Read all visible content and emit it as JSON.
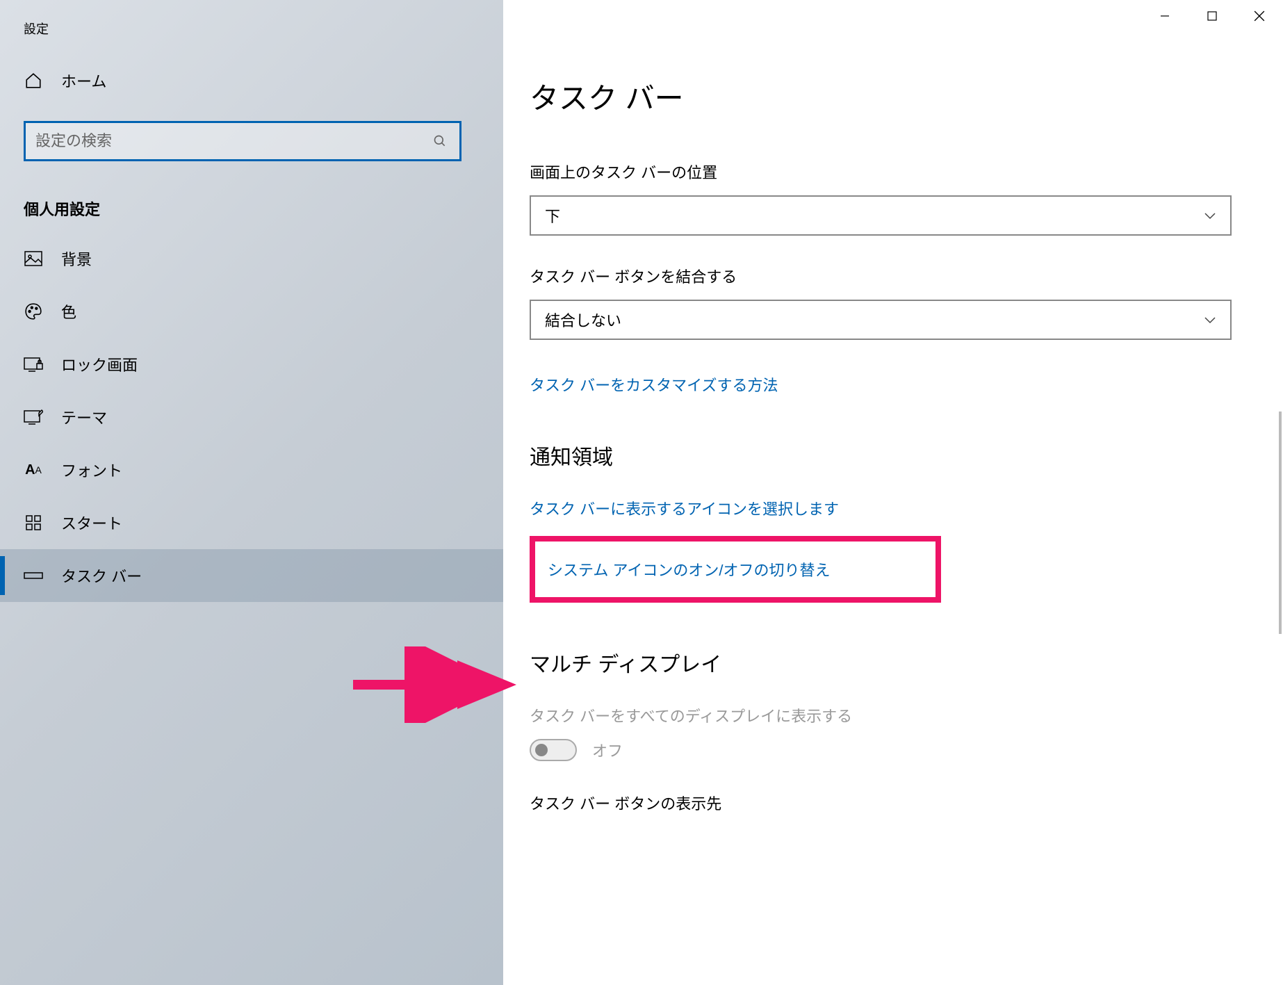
{
  "window": {
    "title": "設定"
  },
  "sidebar": {
    "home_label": "ホーム",
    "search_placeholder": "設定の検索",
    "section_heading": "個人用設定",
    "items": [
      {
        "icon": "image-icon",
        "label": "背景"
      },
      {
        "icon": "palette-icon",
        "label": "色"
      },
      {
        "icon": "lock-screen-icon",
        "label": "ロック画面"
      },
      {
        "icon": "theme-icon",
        "label": "テーマ"
      },
      {
        "icon": "font-icon",
        "label": "フォント"
      },
      {
        "icon": "start-icon",
        "label": "スタート"
      },
      {
        "icon": "taskbar-icon",
        "label": "タスク バー"
      }
    ],
    "selected_index": 6
  },
  "main": {
    "page_title": "タスク バー",
    "position_label": "画面上のタスク バーの位置",
    "position_value": "下",
    "combine_label": "タスク バー ボタンを結合する",
    "combine_value": "結合しない",
    "customize_link": "タスク バーをカスタマイズする方法",
    "notification_heading": "通知領域",
    "select_icons_link": "タスク バーに表示するアイコンを選択します",
    "system_icons_link": "システム アイコンのオン/オフの切り替え",
    "multi_display_heading": "マルチ ディスプレイ",
    "multi_display_label": "タスク バーをすべてのディスプレイに表示する",
    "multi_display_toggle": "オフ",
    "button_display_label": "タスク バー ボタンの表示先"
  }
}
